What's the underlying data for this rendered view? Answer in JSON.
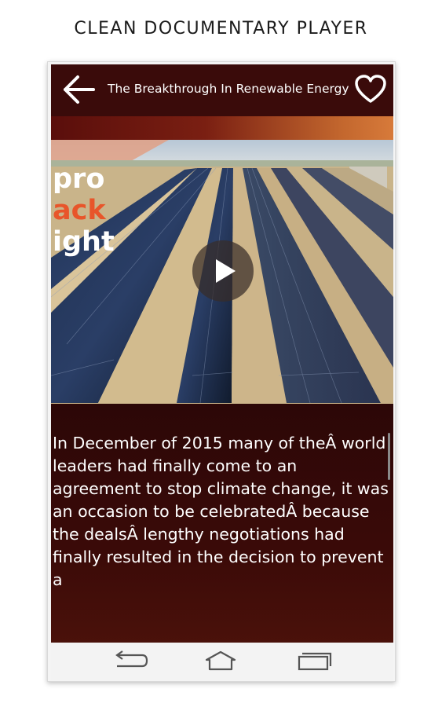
{
  "promo": {
    "title": "CLEAN DOCUMENTARY PLAYER"
  },
  "appbar": {
    "title": "The Breakthrough In Renewable Energy",
    "back_icon": "arrow-left-icon",
    "favorite_icon": "heart-outline-icon"
  },
  "video": {
    "overlay_lines": [
      "pro",
      "ack",
      "ight"
    ],
    "play_icon": "play-icon"
  },
  "description": {
    "text": "In December of 2015 many of theÂ world leaders had finally come to an agreement to stop climate change, it was an occasion to be celebratedÂ because the dealsÂ lengthy negotiations had finally resulted in the decision to prevent a"
  },
  "navbar": {
    "back_icon": "nav-back-icon",
    "home_icon": "nav-home-icon",
    "recent_icon": "nav-recents-icon"
  },
  "colors": {
    "appbar": "#3a0b0a",
    "description_bg": "#2c0707",
    "accent_orange": "#e8552a",
    "navbar": "#f3f3f3"
  }
}
